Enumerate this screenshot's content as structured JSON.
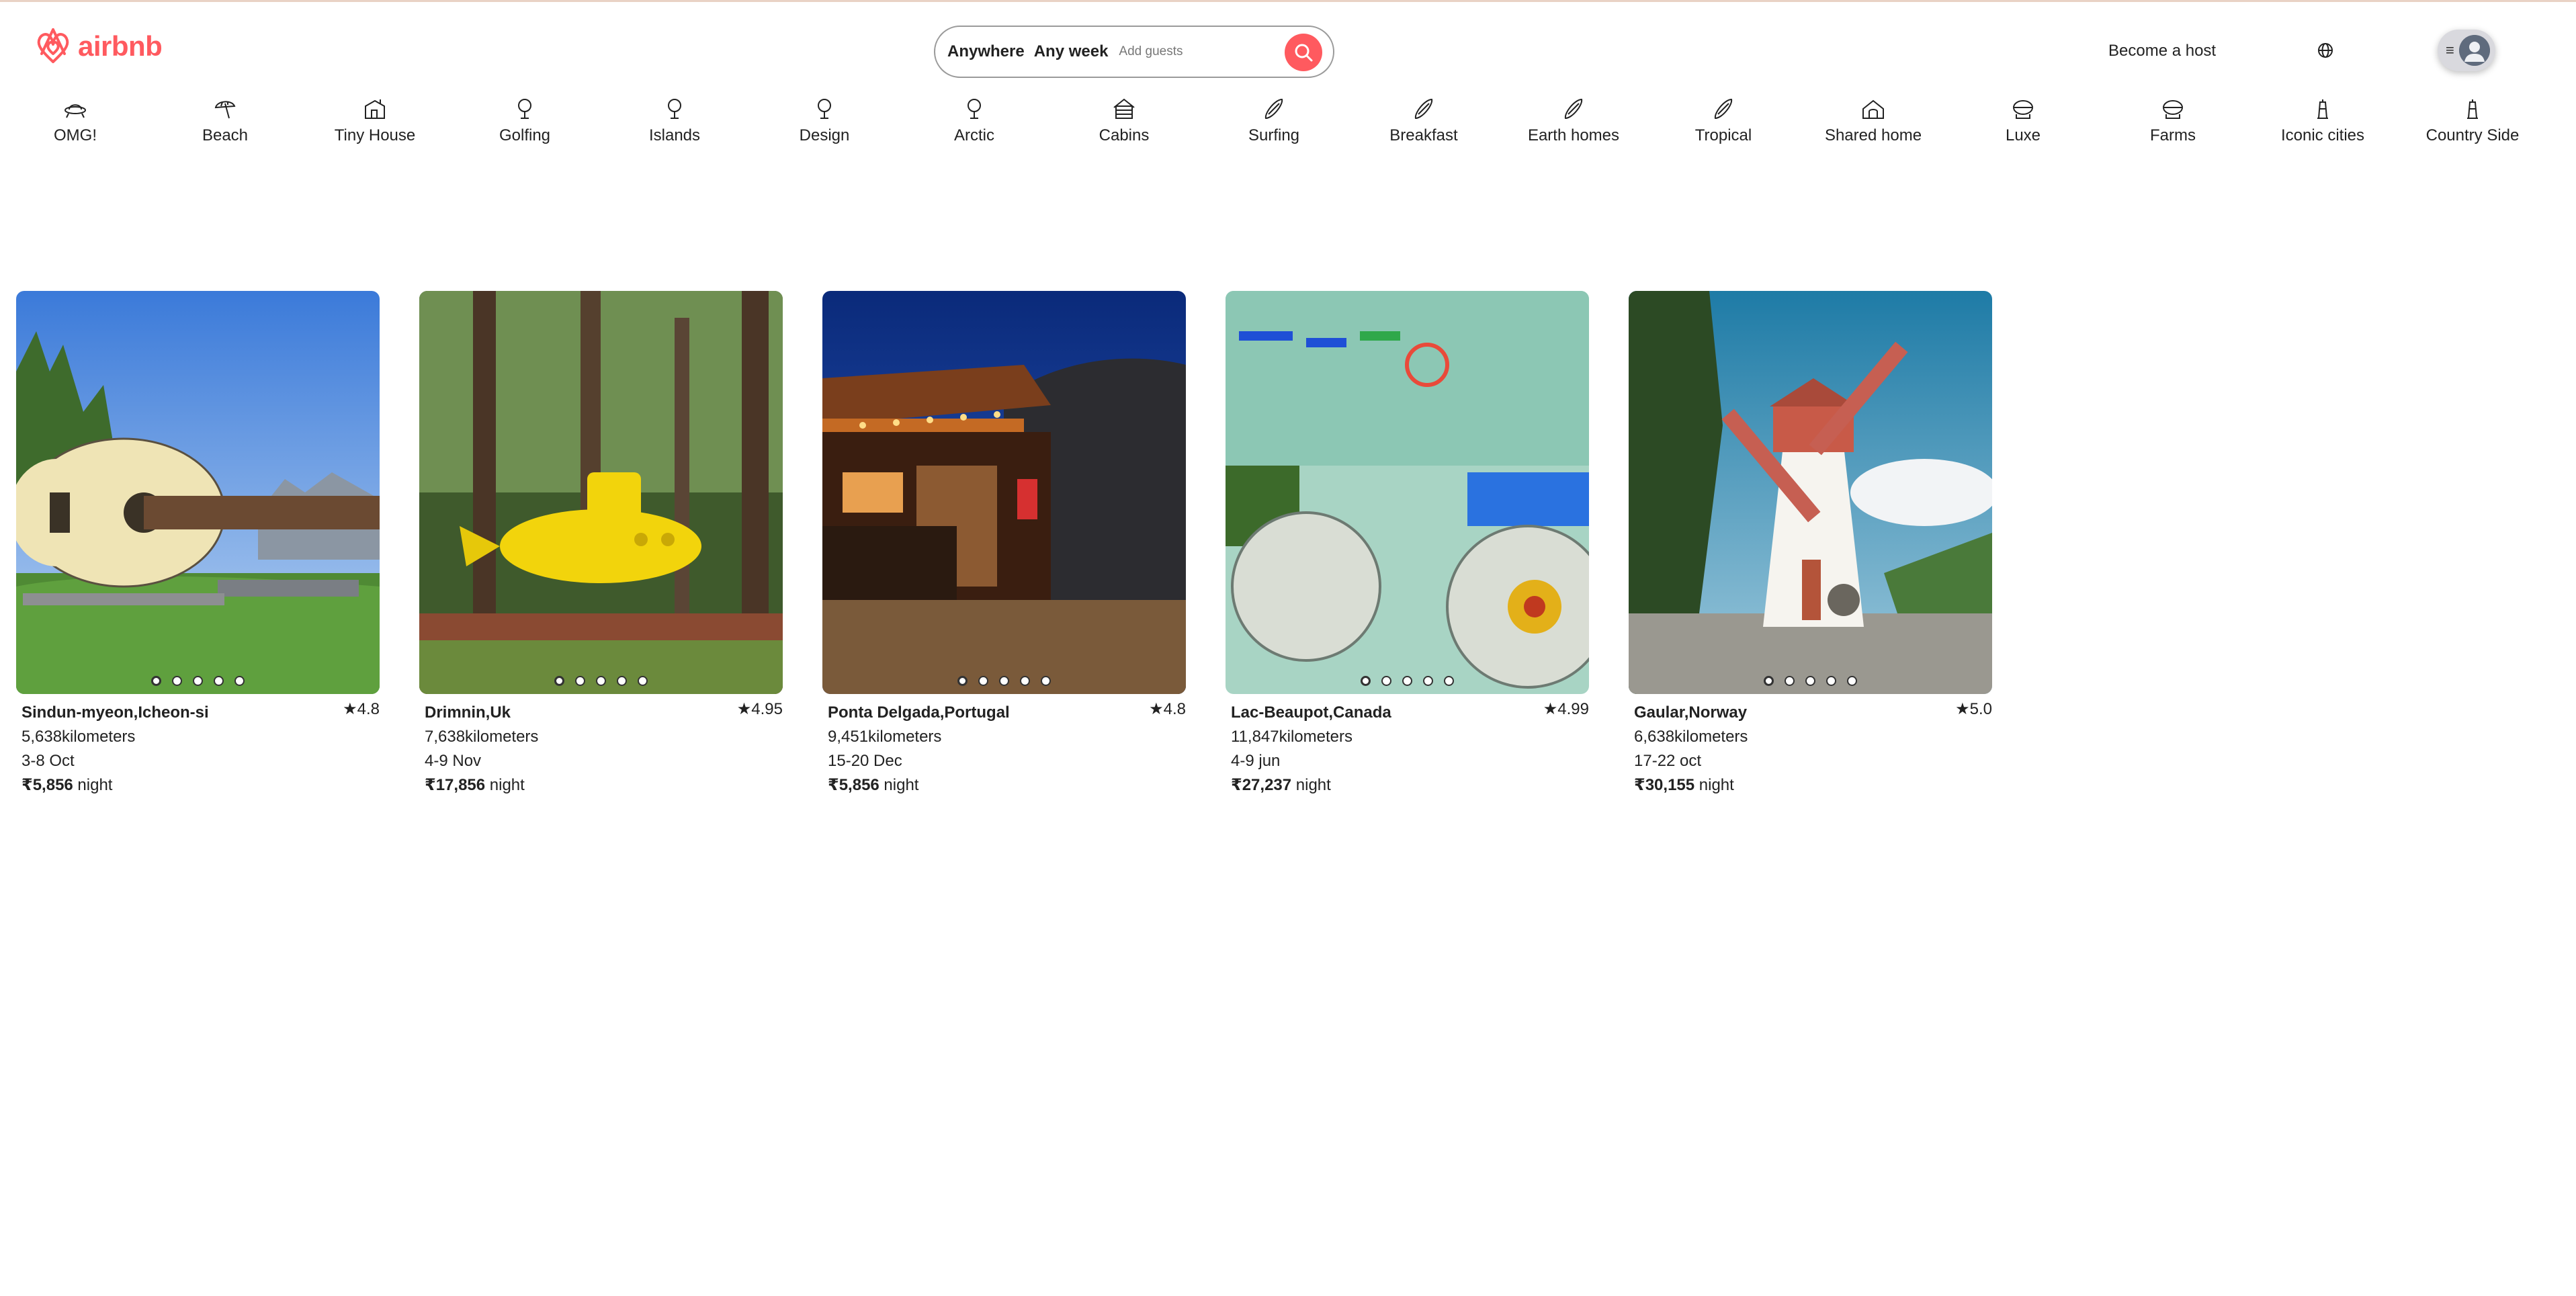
{
  "brand": {
    "name": "airbnb",
    "color": "#ff5a5f"
  },
  "search": {
    "anywhere": "Anywhere",
    "week": "Any week",
    "guests": "Add guests",
    "button_icon": "search-icon"
  },
  "header": {
    "host_link": "Become a host",
    "globe_icon": "globe-icon",
    "menu_icon": "hamburger-icon",
    "avatar_icon": "user-avatar-icon",
    "menu_glyph": "≡"
  },
  "categories": [
    {
      "label": "OMG!",
      "icon": "ufo-icon"
    },
    {
      "label": "Beach",
      "icon": "beach-umbrella-icon"
    },
    {
      "label": "Tiny House",
      "icon": "tiny-house-icon"
    },
    {
      "label": "Golfing",
      "icon": "golf-icon"
    },
    {
      "label": "Islands",
      "icon": "island-icon"
    },
    {
      "label": "Design",
      "icon": "design-icon"
    },
    {
      "label": "Arctic",
      "icon": "arctic-icon"
    },
    {
      "label": "Cabins",
      "icon": "cabin-icon"
    },
    {
      "label": "Surfing",
      "icon": "surfboard-icon"
    },
    {
      "label": "Breakfast",
      "icon": "breakfast-icon"
    },
    {
      "label": "Earth homes",
      "icon": "earth-home-icon"
    },
    {
      "label": "Tropical",
      "icon": "tropical-icon"
    },
    {
      "label": "Shared home",
      "icon": "shared-home-icon"
    },
    {
      "label": "Luxe",
      "icon": "luxe-icon"
    },
    {
      "label": "Farms",
      "icon": "farm-icon"
    },
    {
      "label": "Iconic cities",
      "icon": "iconic-city-icon"
    },
    {
      "label": "Country Side",
      "icon": "countryside-icon"
    }
  ],
  "listings": [
    {
      "place": "Sindun-myeon,Icheon-si",
      "rating": "4.8",
      "distance": "5,638kilometers",
      "dates": "3-8 Oct",
      "price": "₹5,856",
      "unit": " night",
      "photo": "guitar-house"
    },
    {
      "place": "Drimnin,Uk",
      "rating": "4.95",
      "distance": "7,638kilometers",
      "dates": "4-9 Nov",
      "price": "₹17,856",
      "unit": " night",
      "photo": "yellow-submarine"
    },
    {
      "place": "Ponta Delgada,Portugal",
      "rating": "4.8",
      "distance": "9,451kilometers",
      "dates": "15-20 Dec",
      "price": "₹5,856",
      "unit": " night",
      "photo": "lit-cabin"
    },
    {
      "place": "Lac-Beaupot,Canada",
      "rating": "4.99",
      "distance": "11,847kilometers",
      "dates": "4-9 jun",
      "price": "₹27,237",
      "unit": " night",
      "photo": "bottle-house"
    },
    {
      "place": "Gaular,Norway",
      "rating": "5.0",
      "distance": "6,638kilometers",
      "dates": "17-22 oct",
      "price": "₹30,155",
      "unit": " night",
      "photo": "windmill"
    }
  ],
  "rating_star": "★",
  "dots_per_card": 5
}
